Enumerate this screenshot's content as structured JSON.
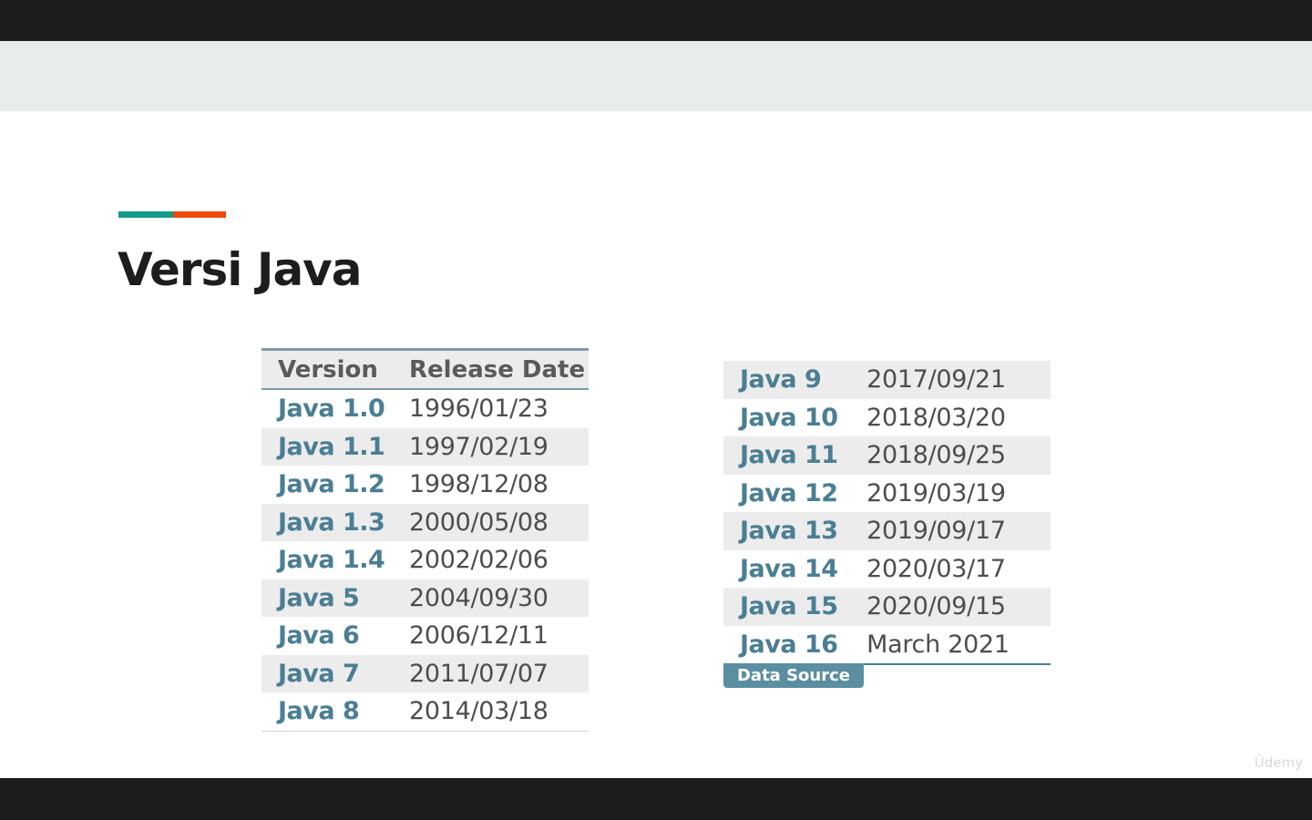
{
  "slide": {
    "title": "Versi Java",
    "colors": {
      "teal": "#14998a",
      "orange": "#ec4a0f",
      "version_text": "#4a7e93",
      "data_source_bg": "#5b8ea1"
    }
  },
  "table_left": {
    "headers": {
      "version": "Version",
      "release_date": "Release Date"
    },
    "rows": [
      {
        "version": "Java 1.0",
        "date": "1996/01/23"
      },
      {
        "version": "Java 1.1",
        "date": "1997/02/19"
      },
      {
        "version": "Java 1.2",
        "date": "1998/12/08"
      },
      {
        "version": "Java 1.3",
        "date": "2000/05/08"
      },
      {
        "version": "Java 1.4",
        "date": "2002/02/06"
      },
      {
        "version": "Java 5",
        "date": "2004/09/30"
      },
      {
        "version": "Java 6",
        "date": "2006/12/11"
      },
      {
        "version": "Java 7",
        "date": "2011/07/07"
      },
      {
        "version": "Java 8",
        "date": "2014/03/18"
      }
    ]
  },
  "table_right": {
    "rows": [
      {
        "version": "Java 9",
        "date": "2017/09/21"
      },
      {
        "version": "Java 10",
        "date": "2018/03/20"
      },
      {
        "version": "Java 11",
        "date": "2018/09/25"
      },
      {
        "version": "Java 12",
        "date": "2019/03/19"
      },
      {
        "version": "Java 13",
        "date": "2019/09/17"
      },
      {
        "version": "Java 14",
        "date": "2020/03/17"
      },
      {
        "version": "Java 15",
        "date": "2020/09/15"
      },
      {
        "version": "Java 16",
        "date": "March 2021"
      }
    ],
    "data_source_label": "Data Source"
  },
  "watermark": "Ûdemy"
}
